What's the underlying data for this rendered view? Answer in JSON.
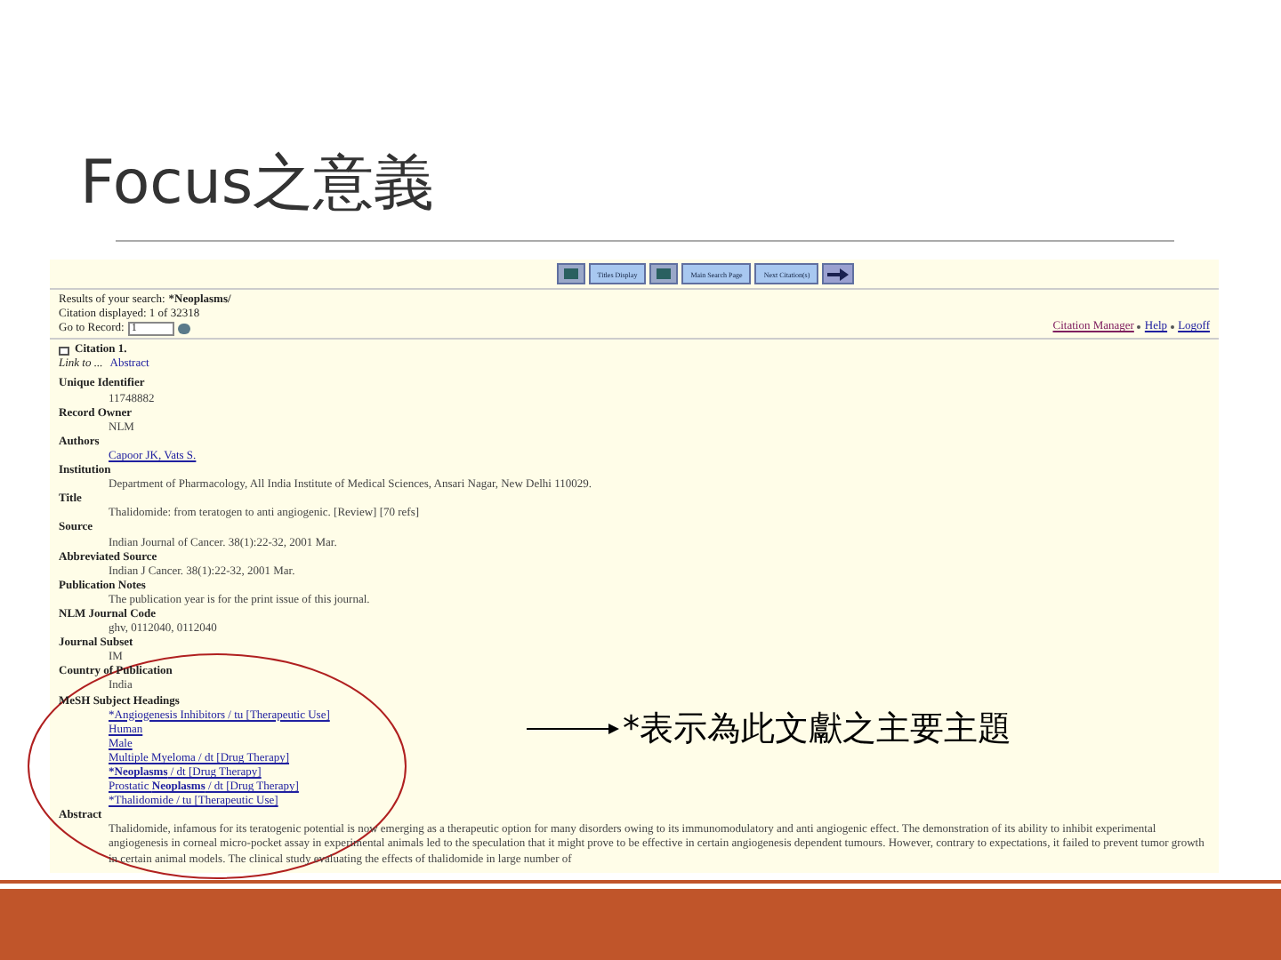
{
  "slide": {
    "title": "Focus之意義",
    "note": "*表示為此文獻之主要主題"
  },
  "page": {
    "toolbar": [
      {
        "kind": "icon"
      },
      {
        "kind": "text",
        "label": "Titles Display"
      },
      {
        "kind": "icon"
      },
      {
        "kind": "text",
        "label": "Main Search Page"
      },
      {
        "kind": "text",
        "label": "Next Citation(s)"
      },
      {
        "kind": "arrow"
      }
    ],
    "results": "Results of your search:",
    "query": "*Neoplasms/",
    "displayed": "Citation displayed: 1 of 32318",
    "go_label": "Go to Record:",
    "go_value": "1",
    "links": [
      "Citation Manager",
      "Help",
      "Logoff"
    ],
    "citation": {
      "label": "Citation 1.",
      "checked": false
    },
    "link_to": "Link to ...",
    "abstract_link": "Abstract",
    "fields": [
      {
        "label": "Unique Identifier",
        "values": [
          {
            "kind": "text",
            "text": "11748882"
          }
        ]
      },
      {
        "label": "Record Owner",
        "values": [
          {
            "kind": "text",
            "text": "NLM"
          }
        ]
      },
      {
        "label": "Authors",
        "values": [
          {
            "kind": "link",
            "text": "Capoor JK, Vats S."
          }
        ]
      },
      {
        "label": "Institution",
        "values": [
          {
            "kind": "text",
            "text": "Department of Pharmacology, All India Institute of Medical Sciences, Ansari Nagar, New Delhi 110029."
          }
        ]
      },
      {
        "label": "Title",
        "values": [
          {
            "kind": "text",
            "text": "Thalidomide: from teratogen to anti angiogenic. [Review] [70 refs]"
          }
        ]
      },
      {
        "label": "Source",
        "values": [
          {
            "kind": "text",
            "text": "Indian Journal of Cancer. 38(1):22-32, 2001 Mar."
          }
        ]
      },
      {
        "label": "Abbreviated Source",
        "values": [
          {
            "kind": "text",
            "text": "Indian J Cancer. 38(1):22-32, 2001 Mar."
          }
        ]
      },
      {
        "label": "Publication Notes",
        "values": [
          {
            "kind": "text",
            "text": "The publication year is for the print issue of this journal."
          }
        ]
      },
      {
        "label": "NLM Journal Code",
        "values": [
          {
            "kind": "text",
            "text": "ghv, 0112040, 0112040"
          }
        ]
      },
      {
        "label": "Journal Subset",
        "values": [
          {
            "kind": "text",
            "text": "IM"
          }
        ]
      },
      {
        "label": "Country of Publication",
        "values": [
          {
            "kind": "text",
            "text": "India"
          }
        ]
      },
      {
        "label": "MeSH Subject Headings",
        "values": [
          {
            "kind": "link",
            "text": "*Angiogenesis Inhibitors / tu [Therapeutic Use]"
          },
          {
            "kind": "link",
            "text": "Human"
          },
          {
            "kind": "link",
            "text": "Male"
          },
          {
            "kind": "link",
            "text": "Multiple Myeloma / dt [Drug Therapy]"
          },
          {
            "kind": "link",
            "parts": [
              {
                "text": "*Neoplasms",
                "bold": true
              },
              {
                "text": " / dt [Drug Therapy]",
                "bold": false
              }
            ]
          },
          {
            "kind": "link",
            "parts": [
              {
                "text": "Prostatic ",
                "bold": false
              },
              {
                "text": "Neoplasms",
                "bold": true
              },
              {
                "text": " / dt [Drug Therapy]",
                "bold": false
              }
            ]
          },
          {
            "kind": "link",
            "text": "*Thalidomide / tu [Therapeutic Use]"
          }
        ]
      },
      {
        "label": "Abstract",
        "values": [
          {
            "kind": "text",
            "text": "Thalidomide, infamous for its teratogenic potential is now emerging as a therapeutic option for many disorders owing to its immunomodulatory and anti angiogenic effect. The demonstration of its ability to inhibit experimental angiogenesis in corneal micro-pocket assay in experimental animals led to the speculation that it might prove to be effective in certain angiogenesis dependent tumours. However, contrary to expectations, it failed to prevent tumor growth in certain animal models. The clinical study evaluating the effects of thalidomide in large number of"
          }
        ]
      }
    ]
  }
}
